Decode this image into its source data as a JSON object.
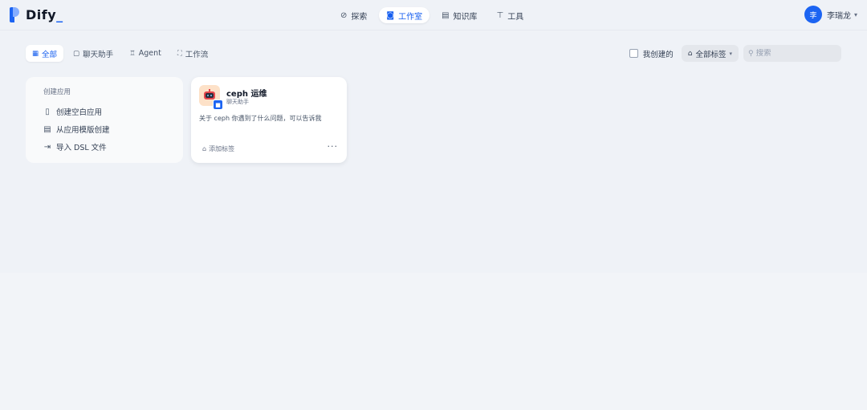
{
  "brand": {
    "name": "Dify",
    "accent": "#1c64f2"
  },
  "nav": {
    "items": [
      {
        "label": "探索",
        "icon": "compass-icon",
        "active": false
      },
      {
        "label": "工作室",
        "icon": "robot-icon",
        "active": true
      },
      {
        "label": "知识库",
        "icon": "book-icon",
        "active": false
      },
      {
        "label": "工具",
        "icon": "hammer-icon",
        "active": false
      }
    ]
  },
  "user": {
    "avatar_initial": "李",
    "name": "李瑞龙"
  },
  "filters": {
    "tabs": [
      {
        "label": "全部",
        "icon": "grid-icon",
        "active": true
      },
      {
        "label": "聊天助手",
        "icon": "chat-icon",
        "active": false
      },
      {
        "label": "Agent",
        "icon": "agent-icon",
        "active": false
      },
      {
        "label": "工作流",
        "icon": "workflow-icon",
        "active": false
      }
    ],
    "created_by_me_label": "我创建的",
    "created_by_me_checked": false,
    "tag_select_label": "全部标签",
    "search_placeholder": "搜索"
  },
  "create_card": {
    "title": "创建应用",
    "items": [
      {
        "label": "创建空白应用",
        "icon": "file-plus-icon"
      },
      {
        "label": "从应用模版创建",
        "icon": "file-template-icon"
      },
      {
        "label": "导入 DSL 文件",
        "icon": "import-icon"
      }
    ]
  },
  "apps": [
    {
      "name": "ceph 运维",
      "type": "聊天助手",
      "description": "关于 ceph 你遇到了什么问题，可以告诉我",
      "add_tag_label": "添加标签",
      "more_label": "···"
    }
  ]
}
